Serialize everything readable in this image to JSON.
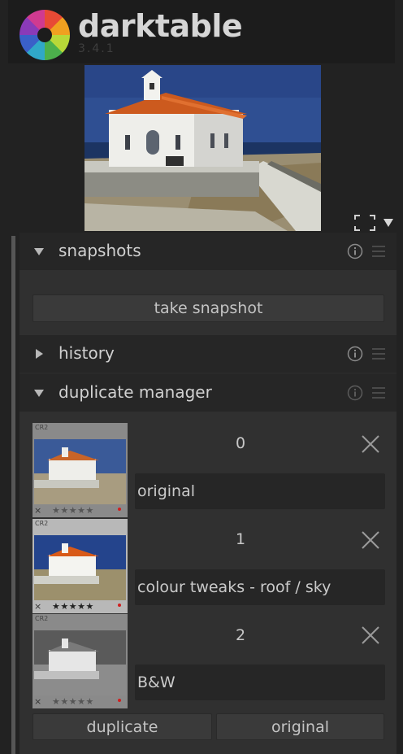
{
  "app": {
    "title": "darktable",
    "version": "3.4.1"
  },
  "icons": {
    "logo": "darktable-aperture-logo",
    "fullscreen": "fullscreen-icon",
    "collapse": "triangle-down-icon",
    "expanded": "triangle-down-icon",
    "collapsed": "triangle-right-icon",
    "info": "info-icon",
    "presets": "hamburger-menu-icon",
    "close": "x-close-icon"
  },
  "modules": {
    "snapshots": {
      "title": "snapshots",
      "expanded": true,
      "take_snapshot_label": "take snapshot"
    },
    "history": {
      "title": "history",
      "expanded": false
    },
    "duplicate_manager": {
      "title": "duplicate manager",
      "expanded": true
    }
  },
  "duplicates": [
    {
      "number": "0",
      "name": "original",
      "format": "CR2",
      "rating": 0,
      "tone": "color-muted"
    },
    {
      "number": "1",
      "name": "colour tweaks - roof / sky",
      "format": "CR2",
      "rating": 5,
      "tone": "color"
    },
    {
      "number": "2",
      "name": "B&W",
      "format": "CR2",
      "rating": 0,
      "tone": "monochrome"
    }
  ],
  "dup_buttons": {
    "duplicate": "duplicate",
    "original": "original"
  },
  "stars_text": "★★★★★",
  "reject_text": "×",
  "colors": {
    "panel_bg": "#2a2a2a",
    "header_bg": "#262626",
    "button_bg": "#3a3a3a",
    "field_bg": "#262626",
    "text": "#c8c8c8",
    "roof": "#c85a20",
    "sky": "#2c4a8c"
  }
}
